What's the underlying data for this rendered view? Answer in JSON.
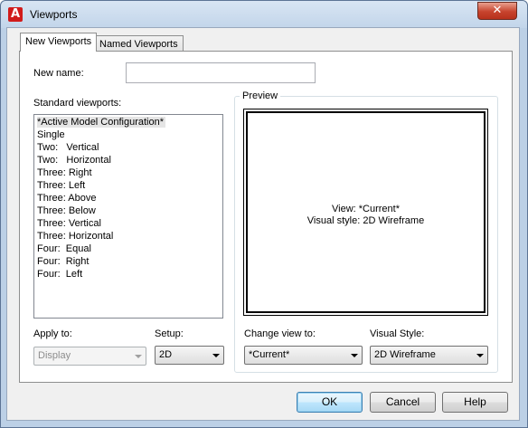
{
  "window": {
    "title": "Viewports",
    "close_glyph": "✕",
    "app_icon_letter": "A"
  },
  "tabs": [
    {
      "label": "New Viewports",
      "active": true
    },
    {
      "label": "Named Viewports",
      "active": false
    }
  ],
  "new_name": {
    "label": "New name:",
    "value": ""
  },
  "standard_viewports": {
    "label": "Standard viewports:",
    "selected_index": 0,
    "items": [
      "*Active Model Configuration*",
      "Single",
      "Two:   Vertical",
      "Two:   Horizontal",
      "Three: Right",
      "Three: Left",
      "Three: Above",
      "Three: Below",
      "Three: Vertical",
      "Three: Horizontal",
      "Four:  Equal",
      "Four:  Right",
      "Four:  Left"
    ]
  },
  "preview": {
    "group_label": "Preview",
    "view_line": "View: *Current*",
    "style_line": "Visual style: 2D Wireframe"
  },
  "apply_to": {
    "label": "Apply to:",
    "value": "Display",
    "enabled": false
  },
  "setup": {
    "label": "Setup:",
    "value": "2D"
  },
  "change_view_to": {
    "label": "Change view to:",
    "value": "*Current*"
  },
  "visual_style": {
    "label": "Visual Style:",
    "value": "2D Wireframe"
  },
  "buttons": {
    "ok": "OK",
    "cancel": "Cancel",
    "help": "Help"
  },
  "colors": {
    "window_frame": "#bcd0e6",
    "close_button": "#c7432d",
    "panel_bg": "#ffffff",
    "dialog_bg": "#f0f0f0",
    "selection_bg": "#e5e5e5"
  }
}
